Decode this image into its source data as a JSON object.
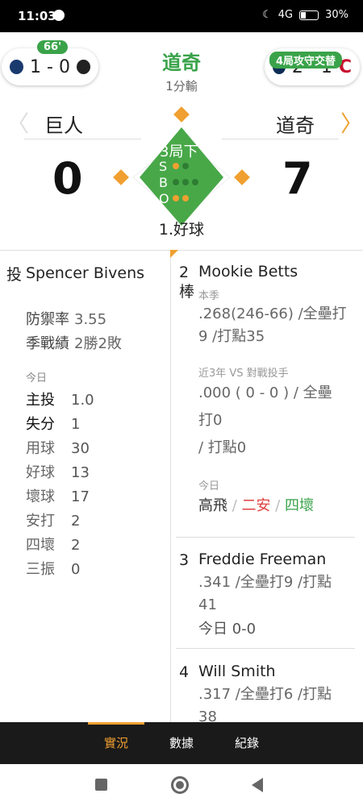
{
  "status_bar": {
    "time": "11:03",
    "network": "4G",
    "battery": "30%"
  },
  "other_games": {
    "left": {
      "score": "1 - 0",
      "badge": "66'"
    },
    "right": {
      "score": "2 - 1",
      "badge": "4局攻守交替"
    }
  },
  "game": {
    "header_team": "道奇",
    "header_sub": "1分輸",
    "away_team": "巨人",
    "home_team": "道奇",
    "away_score": "0",
    "home_score": "7",
    "inning": "3局下",
    "count_labels": [
      "S",
      "B",
      "O"
    ],
    "strikes": 1,
    "balls": 0,
    "outs": 2,
    "pitch_result": "1.好球"
  },
  "pitcher": {
    "tag": "投",
    "name": "Spencer Bivens",
    "era_label": "防禦率",
    "era_value": "3.55",
    "record_label": "季戰績",
    "record_value": "2勝2敗",
    "today_label": "今日",
    "stats": [
      {
        "label": "主投",
        "value": "1.0",
        "bold": true
      },
      {
        "label": "失分",
        "value": "1",
        "bold": true
      },
      {
        "label": "用球",
        "value": "30",
        "bold": false
      },
      {
        "label": "好球",
        "value": "13",
        "bold": false
      },
      {
        "label": "壞球",
        "value": "17",
        "bold": false
      },
      {
        "label": "安打",
        "value": "2",
        "bold": false
      },
      {
        "label": "四壞",
        "value": "2",
        "bold": false
      },
      {
        "label": "三振",
        "value": "0",
        "bold": false
      }
    ]
  },
  "batters": [
    {
      "order": "2",
      "tag": "棒",
      "name": "Mookie Betts",
      "season_label": "本季",
      "season_line_1": ".268(246-66) /全壘打",
      "season_line_2": "9 /打點35",
      "vs_label": "近3年 VS 對戰投手",
      "vs_line_1": ".000 ( 0 - 0 ) / 全壘",
      "vs_line_2": "打0",
      "vs_line_3": "/ 打點0",
      "today_label": "今日",
      "today_results": [
        "高飛",
        "二安",
        "四壞"
      ]
    },
    {
      "order": "3",
      "name": "Freddie Freeman",
      "line_1": ".341 /全壘打9 /打點",
      "line_2": "41",
      "today": "今日 0-0"
    },
    {
      "order": "4",
      "name": "Will Smith",
      "line_1": ".317 /全壘打6 /打點",
      "line_2": "38"
    }
  ],
  "tabs": [
    "實況",
    "數據",
    "紀錄"
  ],
  "colors": {
    "accent": "#f0a030",
    "green": "#3aa34a",
    "red": "#e04040"
  }
}
